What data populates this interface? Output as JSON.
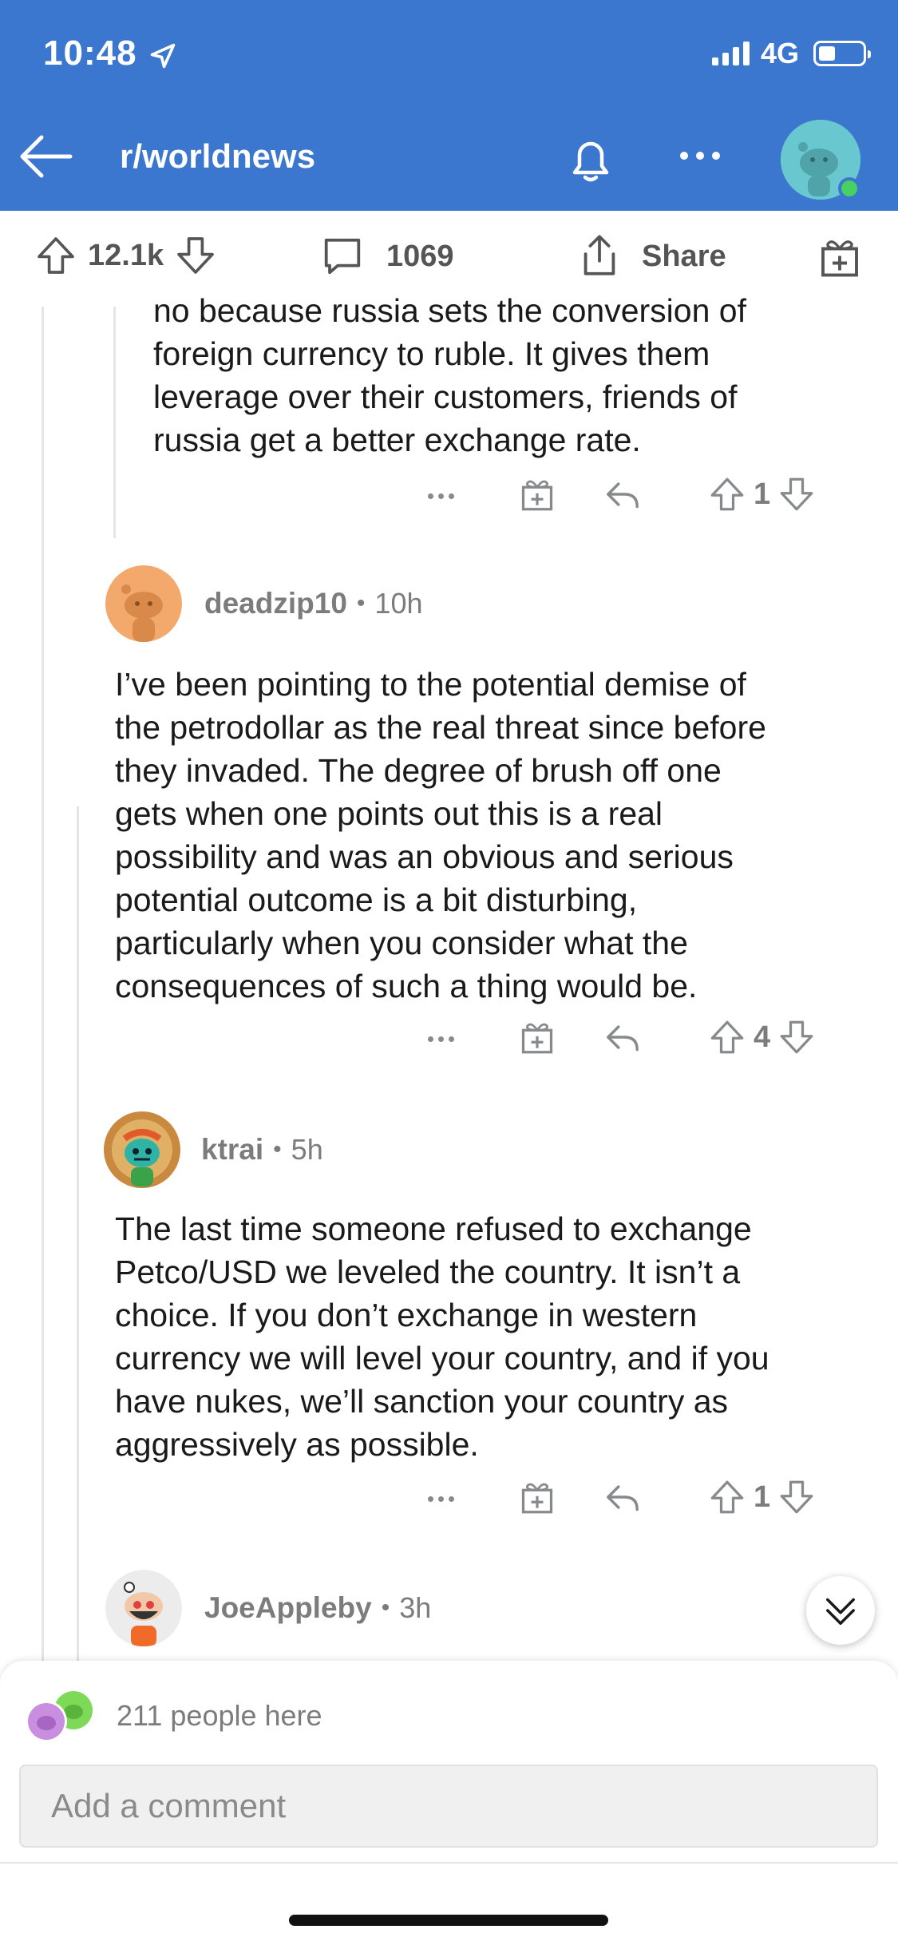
{
  "status_bar": {
    "time": "10:48",
    "network": "4G"
  },
  "header": {
    "subreddit": "r/worldnews"
  },
  "post_actions": {
    "votes": "12.1k",
    "comments": "1069",
    "share": "Share"
  },
  "comments": [
    {
      "text_lines": [
        "no because russia sets the conversion of",
        "foreign currency to ruble. It gives them",
        "leverage over their customers, friends of",
        "russia get a better exchange rate."
      ],
      "score": "1"
    },
    {
      "author": "deadzip10",
      "time": "10h",
      "text_lines": [
        "I’ve been pointing to the potential demise of",
        "the petrodollar as the real threat since before",
        "they invaded. The degree of brush off one",
        "gets when one points out this is a real",
        "possibility and was an obvious and serious",
        "potential outcome is a bit disturbing,",
        "particularly when you consider what the",
        "consequences of such a thing would be."
      ],
      "score": "4",
      "avatar_color": "#f2a96b"
    },
    {
      "author": "ktrai",
      "time": "5h",
      "text_lines": [
        "The last time someone refused to exchange",
        "Petco/USD we leveled the country. It isn’t a",
        "choice. If you don’t exchange in western",
        "currency we will level your country, and if you",
        "have nukes, we’ll sanction your country as",
        "aggressively as possible."
      ],
      "score": "1",
      "avatar_color": "#d9a55b"
    },
    {
      "author": "JoeAppleby",
      "time": "3h",
      "avatar_color": "#e8e8e8"
    }
  ],
  "composer": {
    "presence_text": "211 people here",
    "placeholder": "Add a comment"
  },
  "colors": {
    "header_bg": "#3b76cf",
    "accent": "#0079d3",
    "muted_text": "#7c7c7c"
  }
}
